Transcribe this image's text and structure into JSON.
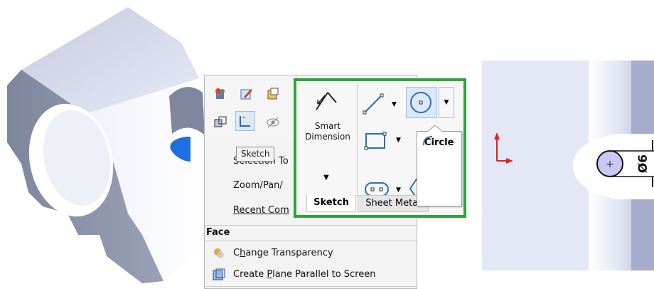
{
  "mini_toolbar": {
    "tooltip": "Sketch"
  },
  "context_menu": {
    "items": {
      "selection_tools": "Selection To",
      "zoom_pan": "Zoom/Pan/",
      "recent_commands": "Recent Com"
    },
    "section_face": "Face",
    "change_transparency_pre": "C",
    "change_transparency_ul": "h",
    "change_transparency_post": "ange Transparency",
    "create_plane_pre": "Create ",
    "create_plane_ul": "P",
    "create_plane_post": "lane Parallel to Screen"
  },
  "ribbon": {
    "smart_dimension_line1": "Smart",
    "smart_dimension_line2": "Dimension",
    "tab_sketch": "Sketch",
    "tab_sheet_metal": "Sheet Metal",
    "circle_tooltip": "Circle"
  },
  "sketch_view": {
    "dimension_label": "Ø6"
  },
  "colors": {
    "highlight_green": "#2fa33a",
    "selection_blue": "#1f6fe0",
    "axis_red": "#e0201f",
    "circle_fill": "#c9c7f3"
  }
}
